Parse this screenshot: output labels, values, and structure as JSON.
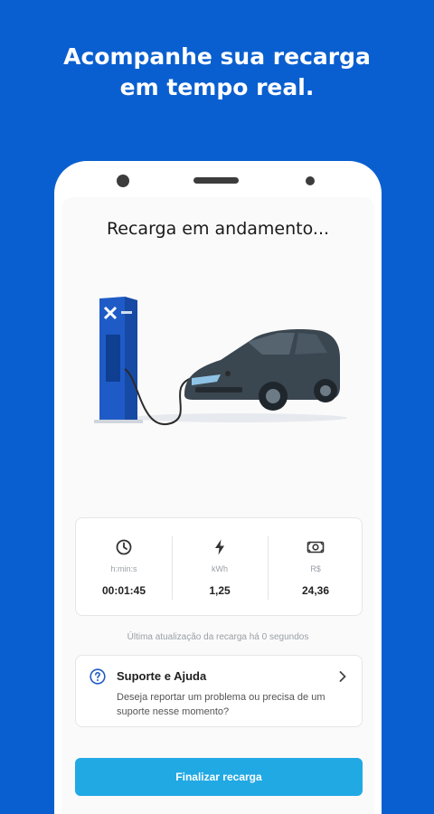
{
  "headline": {
    "line1": "Acompanhe sua recarga",
    "line2": "em tempo real."
  },
  "screen": {
    "title": "Recarga em andamento...",
    "stats": [
      {
        "icon": "clock-icon",
        "label": "h:min:s",
        "value": "00:01:45"
      },
      {
        "icon": "lightning-icon",
        "label": "kWh",
        "value": "1,25"
      },
      {
        "icon": "money-icon",
        "label": "R$",
        "value": "24,36"
      }
    ],
    "update_note": "Última atualização da recarga há 0 segundos",
    "support": {
      "title": "Suporte e Ajuda",
      "description": "Deseja reportar um problema ou precisa de um suporte nesse momento?"
    },
    "finish_button": "Finalizar recarga"
  },
  "colors": {
    "background": "#0a5fd0",
    "button": "#21a9e4",
    "charger": "#1f5bc7",
    "car": "#3a4650"
  }
}
